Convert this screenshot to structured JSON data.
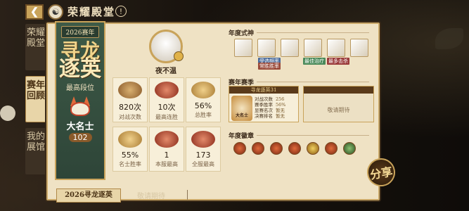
{
  "header": {
    "title": "荣耀殿堂",
    "back_icon": "back-arrow-icon",
    "logo_icon": "onmyoji-logo-icon",
    "tip_icon": "exclamation-icon",
    "tip_glyph": "!"
  },
  "side_tabs": [
    {
      "label": "荣耀殿堂",
      "active": false
    },
    {
      "label": "赛年回顾",
      "active": true
    },
    {
      "label": "我的展馆",
      "active": false
    }
  ],
  "banner": {
    "year": "2026赛年",
    "title_1": "寻龙",
    "title_2": "逐英",
    "rank_label": "最高段位",
    "rank_name": "大名士",
    "rank_num": "102"
  },
  "player": {
    "name": "夜不温"
  },
  "stats": [
    {
      "value": "820次",
      "label": "对战次数"
    },
    {
      "value": "10次",
      "label": "最高连胜"
    },
    {
      "value": "56%",
      "label": "总胜率"
    },
    {
      "value": "55%",
      "label": "名士胜率"
    },
    {
      "value": "1",
      "label": "本服最高"
    },
    {
      "value": "173",
      "label": "全服最高"
    }
  ],
  "yearly_shikigami": {
    "title": "年度式神",
    "tags": [
      "受选频率",
      "常胜胜率",
      "最佳治疗",
      "最多击杀"
    ]
  },
  "season": {
    "title": "赛年赛季",
    "card_title": "寻龙逐英31",
    "rank_name": "大名士",
    "lines": [
      {
        "k": "对战次数",
        "v": "256"
      },
      {
        "k": "赛季胜率",
        "v": "56%"
      },
      {
        "k": "显赛名次",
        "v": "暂无"
      },
      {
        "k": "决赛排名",
        "v": "暂无"
      }
    ],
    "pending": "敬请期待"
  },
  "medals": {
    "title": "年度徽章"
  },
  "share_label": "分享",
  "bottom_tabs": {
    "active": "2026寻龙逐英",
    "pending": "敬请期待"
  },
  "colors": {
    "accent": "#c9a35a",
    "panel": "#efe2c4",
    "banner": "#3d5a47"
  }
}
